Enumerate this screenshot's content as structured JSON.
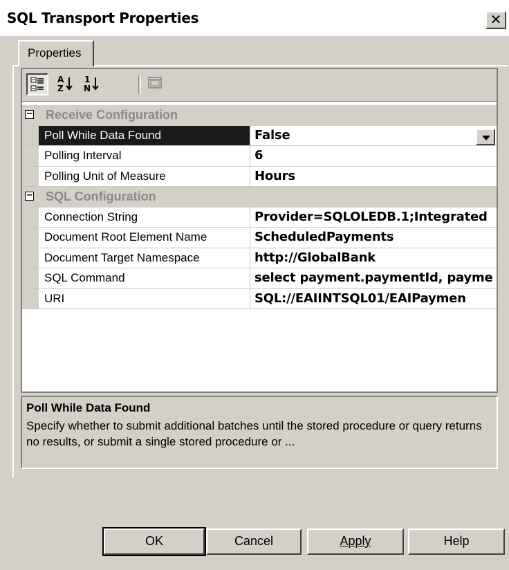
{
  "window": {
    "title": "SQL Transport Properties",
    "close_glyph": "✕"
  },
  "tabs": [
    {
      "label": "Properties"
    }
  ],
  "toolbar": {
    "buttons": [
      {
        "icon": "categorized-view-icon",
        "pressed": true
      },
      {
        "icon": "sort-alphabetical-icon",
        "pressed": false
      },
      {
        "icon": "sort-numeric-icon",
        "pressed": false
      },
      {
        "icon": "property-pages-icon",
        "pressed": false
      }
    ],
    "az_top": "A",
    "az_bottom": "Z",
    "num_top": "1",
    "num_bottom": "N"
  },
  "grid": {
    "categories": [
      {
        "label": "Receive Configuration",
        "expander": "−",
        "properties": [
          {
            "name": "Poll While Data Found",
            "value": "False",
            "selected": true,
            "dropdown": true
          },
          {
            "name": "Polling Interval",
            "value": "6"
          },
          {
            "name": "Polling Unit of Measure",
            "value": "Hours"
          }
        ]
      },
      {
        "label": "SQL Configuration",
        "expander": "−",
        "properties": [
          {
            "name": "Connection String",
            "value": "Provider=SQLOLEDB.1;Integrated"
          },
          {
            "name": "Document Root Element Name",
            "value": "ScheduledPayments"
          },
          {
            "name": "Document Target Namespace",
            "value": "http://GlobalBank"
          },
          {
            "name": "SQL Command",
            "value": "select payment.paymentId, payme"
          },
          {
            "name": "URI",
            "value": "SQL://EAIINTSQL01/EAIPaymen"
          }
        ]
      }
    ]
  },
  "description": {
    "title": "Poll While Data Found",
    "text": "Specify whether to submit additional batches until the stored procedure or query returns no results, or submit a single stored procedure or ..."
  },
  "buttons": {
    "ok": "OK",
    "cancel": "Cancel",
    "apply": "Apply",
    "help": "Help"
  },
  "colors": {
    "face": "#d4d0c8",
    "selection": "#1a1a1a",
    "category_text": "#8a8a8a"
  }
}
